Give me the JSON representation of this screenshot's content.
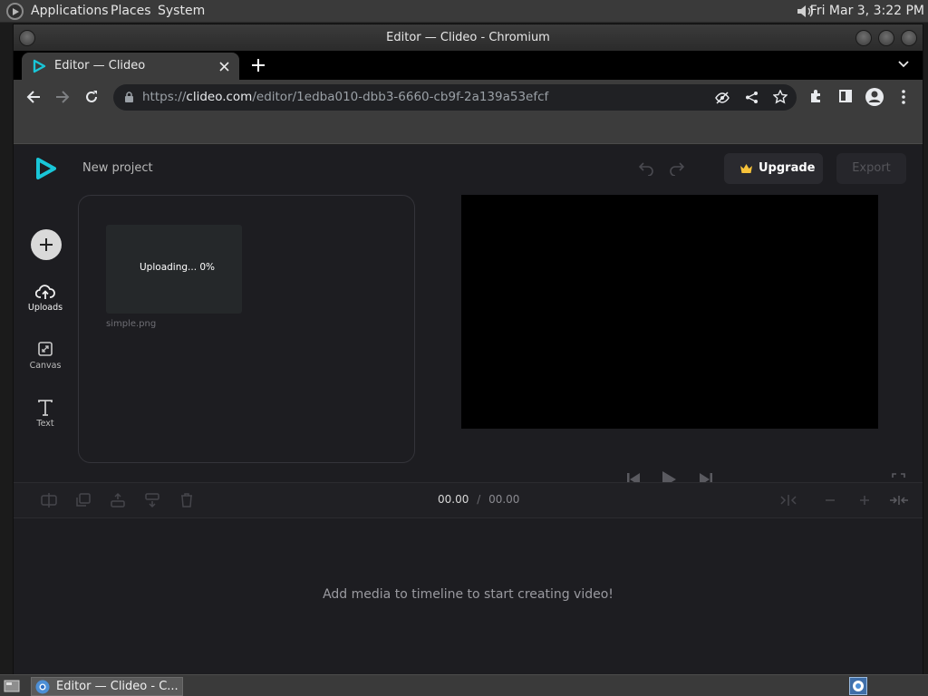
{
  "top_panel": {
    "menus": [
      "Applications",
      "Places",
      "System"
    ],
    "clock": "Fri Mar  3,  3:22 PM"
  },
  "window": {
    "title": "Editor — Clideo - Chromium"
  },
  "browser": {
    "tab_title": "Editor — Clideo",
    "url_scheme": "https://",
    "url_host": "clideo.com",
    "url_path": "/editor/1edba010-dbb3-6660-cb9f-2a139a53efcf"
  },
  "app": {
    "project_name": "New project",
    "upgrade_label": "Upgrade",
    "export_label": "Export",
    "sidebar": [
      {
        "label": "Uploads",
        "icon": "upload-cloud-icon"
      },
      {
        "label": "Canvas",
        "icon": "canvas-icon"
      },
      {
        "label": "Text",
        "icon": "text-icon"
      }
    ],
    "media": {
      "status": "Uploading... 0%",
      "file_name": "simple.png"
    },
    "time_current": "00.00",
    "time_separator": "/",
    "time_total": "00.00",
    "timeline_empty": "Add media to timeline to start creating video!"
  },
  "taskbar": {
    "item_label": "Editor — Clideo - C..."
  },
  "colors": {
    "accent": "#19c6d8",
    "crown": "#f6c23a",
    "app_bg": "#1d1d21"
  }
}
